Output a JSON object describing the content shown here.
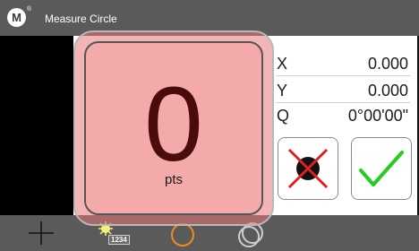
{
  "app": {
    "logo_letter": "M",
    "logo_sup": "®",
    "title": "Measure Circle"
  },
  "readout": {
    "x": {
      "axis": "X",
      "value": "0.000"
    },
    "y": {
      "axis": "Y",
      "value": "0.000"
    },
    "q": {
      "axis": "Q",
      "value": "0°00'00\""
    }
  },
  "points": {
    "count": "0",
    "unit": "pts"
  },
  "actions": {
    "cancel_icon": "cancel-x-icon",
    "confirm_icon": "checkmark-icon"
  },
  "toolbar": {
    "items": [
      {
        "icon": "crosshair-icon"
      },
      {
        "icon": "numeric-keypad-icon",
        "label": "1234"
      },
      {
        "icon": "circle-icon",
        "color": "#f08a1e"
      },
      {
        "icon": "concentric-circles-icon"
      }
    ]
  },
  "colors": {
    "bar": "#5a5a5a",
    "overlay": "#f4aaaa",
    "count_text": "#4a0b0b",
    "confirm_green": "#22cc22",
    "cancel_red": "#e02020"
  }
}
